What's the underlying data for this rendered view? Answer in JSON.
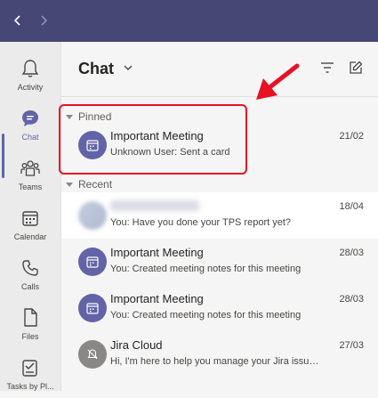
{
  "topbar": {
    "back_icon": "chevron-left-icon",
    "forward_icon": "chevron-right-icon"
  },
  "rail": {
    "items": [
      {
        "label": "Activity",
        "icon": "bell-icon",
        "active": false
      },
      {
        "label": "Chat",
        "icon": "chat-icon",
        "active": true
      },
      {
        "label": "Teams",
        "icon": "teams-icon",
        "active": false
      },
      {
        "label": "Calendar",
        "icon": "calendar-icon",
        "active": false
      },
      {
        "label": "Calls",
        "icon": "phone-icon",
        "active": false
      },
      {
        "label": "Files",
        "icon": "file-icon",
        "active": false
      },
      {
        "label": "Tasks by Pl...",
        "icon": "tasks-icon",
        "active": false
      }
    ]
  },
  "chat": {
    "title": "Chat",
    "filter_icon": "filter-icon",
    "compose_icon": "new-chat-icon",
    "pinned_label": "Pinned",
    "recent_label": "Recent",
    "pinned": [
      {
        "name": "Important Meeting",
        "message": "Unknown User: Sent a card",
        "date": "21/02"
      }
    ],
    "recent": [
      {
        "name": "",
        "message": "You: Have you done your TPS report yet?",
        "date": "18/04"
      },
      {
        "name": "Important Meeting",
        "message": "You: Created meeting notes for this meeting",
        "date": "28/03"
      },
      {
        "name": "Important Meeting",
        "message": "You: Created meeting notes for this meeting",
        "date": "28/03"
      },
      {
        "name": "Jira Cloud",
        "message": "Hi, I'm here to help you manage your Jira issues....",
        "date": "27/03"
      }
    ]
  },
  "colors": {
    "brand": "#464775",
    "accent": "#6264a7",
    "highlight": "#e81123"
  }
}
